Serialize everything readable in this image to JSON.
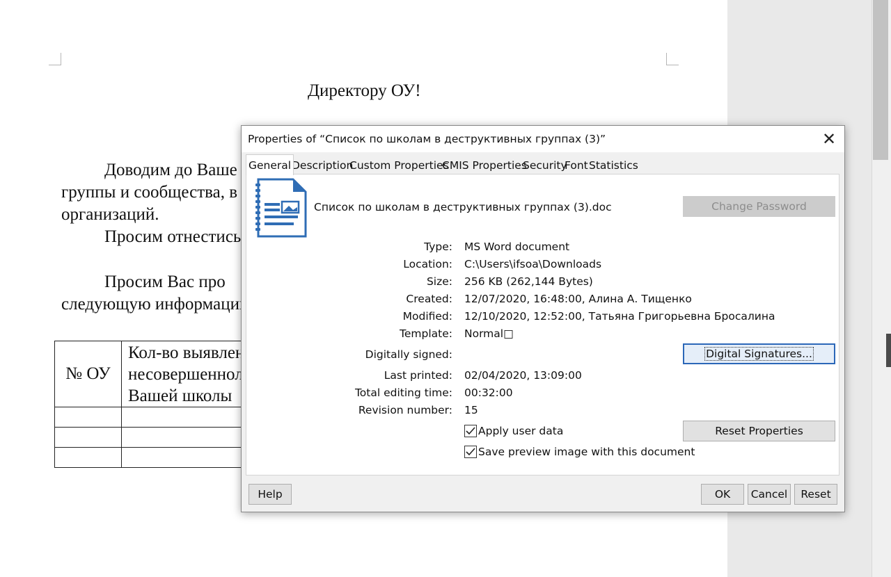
{
  "document": {
    "heading": "Директору ОУ!",
    "para1_line1": "Доводим   до   Ваше",
    "para1_line2": "группы  и  сообщества,  в",
    "para1_line3": "организаций.",
    "para2_line1": "Просим отнестись",
    "para3_line1": "Просим    Вас    про",
    "para3_line2": "следующую информацин",
    "table": {
      "col1_header": "№ ОУ",
      "col2_header_line1": "Кол-во выявлен",
      "col2_header_line2": "несовершенноле",
      "col2_header_line3": "Вашей школы"
    }
  },
  "dialog": {
    "title": "Properties of “Список по школам в деструктивных группах (3)”",
    "close_icon": "close-icon",
    "tabs": [
      "General",
      "Description",
      "Custom Properties",
      "CMIS Properties",
      "Security",
      "Font",
      "Statistics"
    ],
    "active_tab": "General",
    "file_icon": "word-document-icon",
    "file_name": "Список по школам в деструктивных группах (3).doc",
    "change_password_label": "Change Password",
    "fields": {
      "type_label": "Type:",
      "type_value": "MS Word document",
      "location_label": "Location:",
      "location_value": "C:\\Users\\ifsoa\\Downloads",
      "size_label": "Size:",
      "size_value": "256 KB (262,144 Bytes)",
      "created_label": "Created:",
      "created_value": "12/07/2020, 16:48:00, Алина А. Тищенко",
      "modified_label": "Modified:",
      "modified_value": "12/10/2020, 12:52:00, Татьяна Григорьевна Бросалина",
      "template_label": "Template:",
      "template_value": "Normal□",
      "signed_label": "Digitally signed:",
      "printed_label": "Last printed:",
      "printed_value": "02/04/2020, 13:09:00",
      "editing_label": "Total editing time:",
      "editing_value": "00:32:00",
      "revision_label": "Revision number:",
      "revision_value": "15"
    },
    "digital_signatures_label": "Digital Signatures...",
    "apply_user_data_label": "Apply user data",
    "apply_user_data_checked": true,
    "save_preview_label": "Save preview image with this document",
    "save_preview_checked": true,
    "reset_properties_label": "Reset Properties",
    "help_label": "Help",
    "ok_label": "OK",
    "cancel_label": "Cancel",
    "reset_label": "Reset",
    "accent_color": "#2b67b8"
  }
}
